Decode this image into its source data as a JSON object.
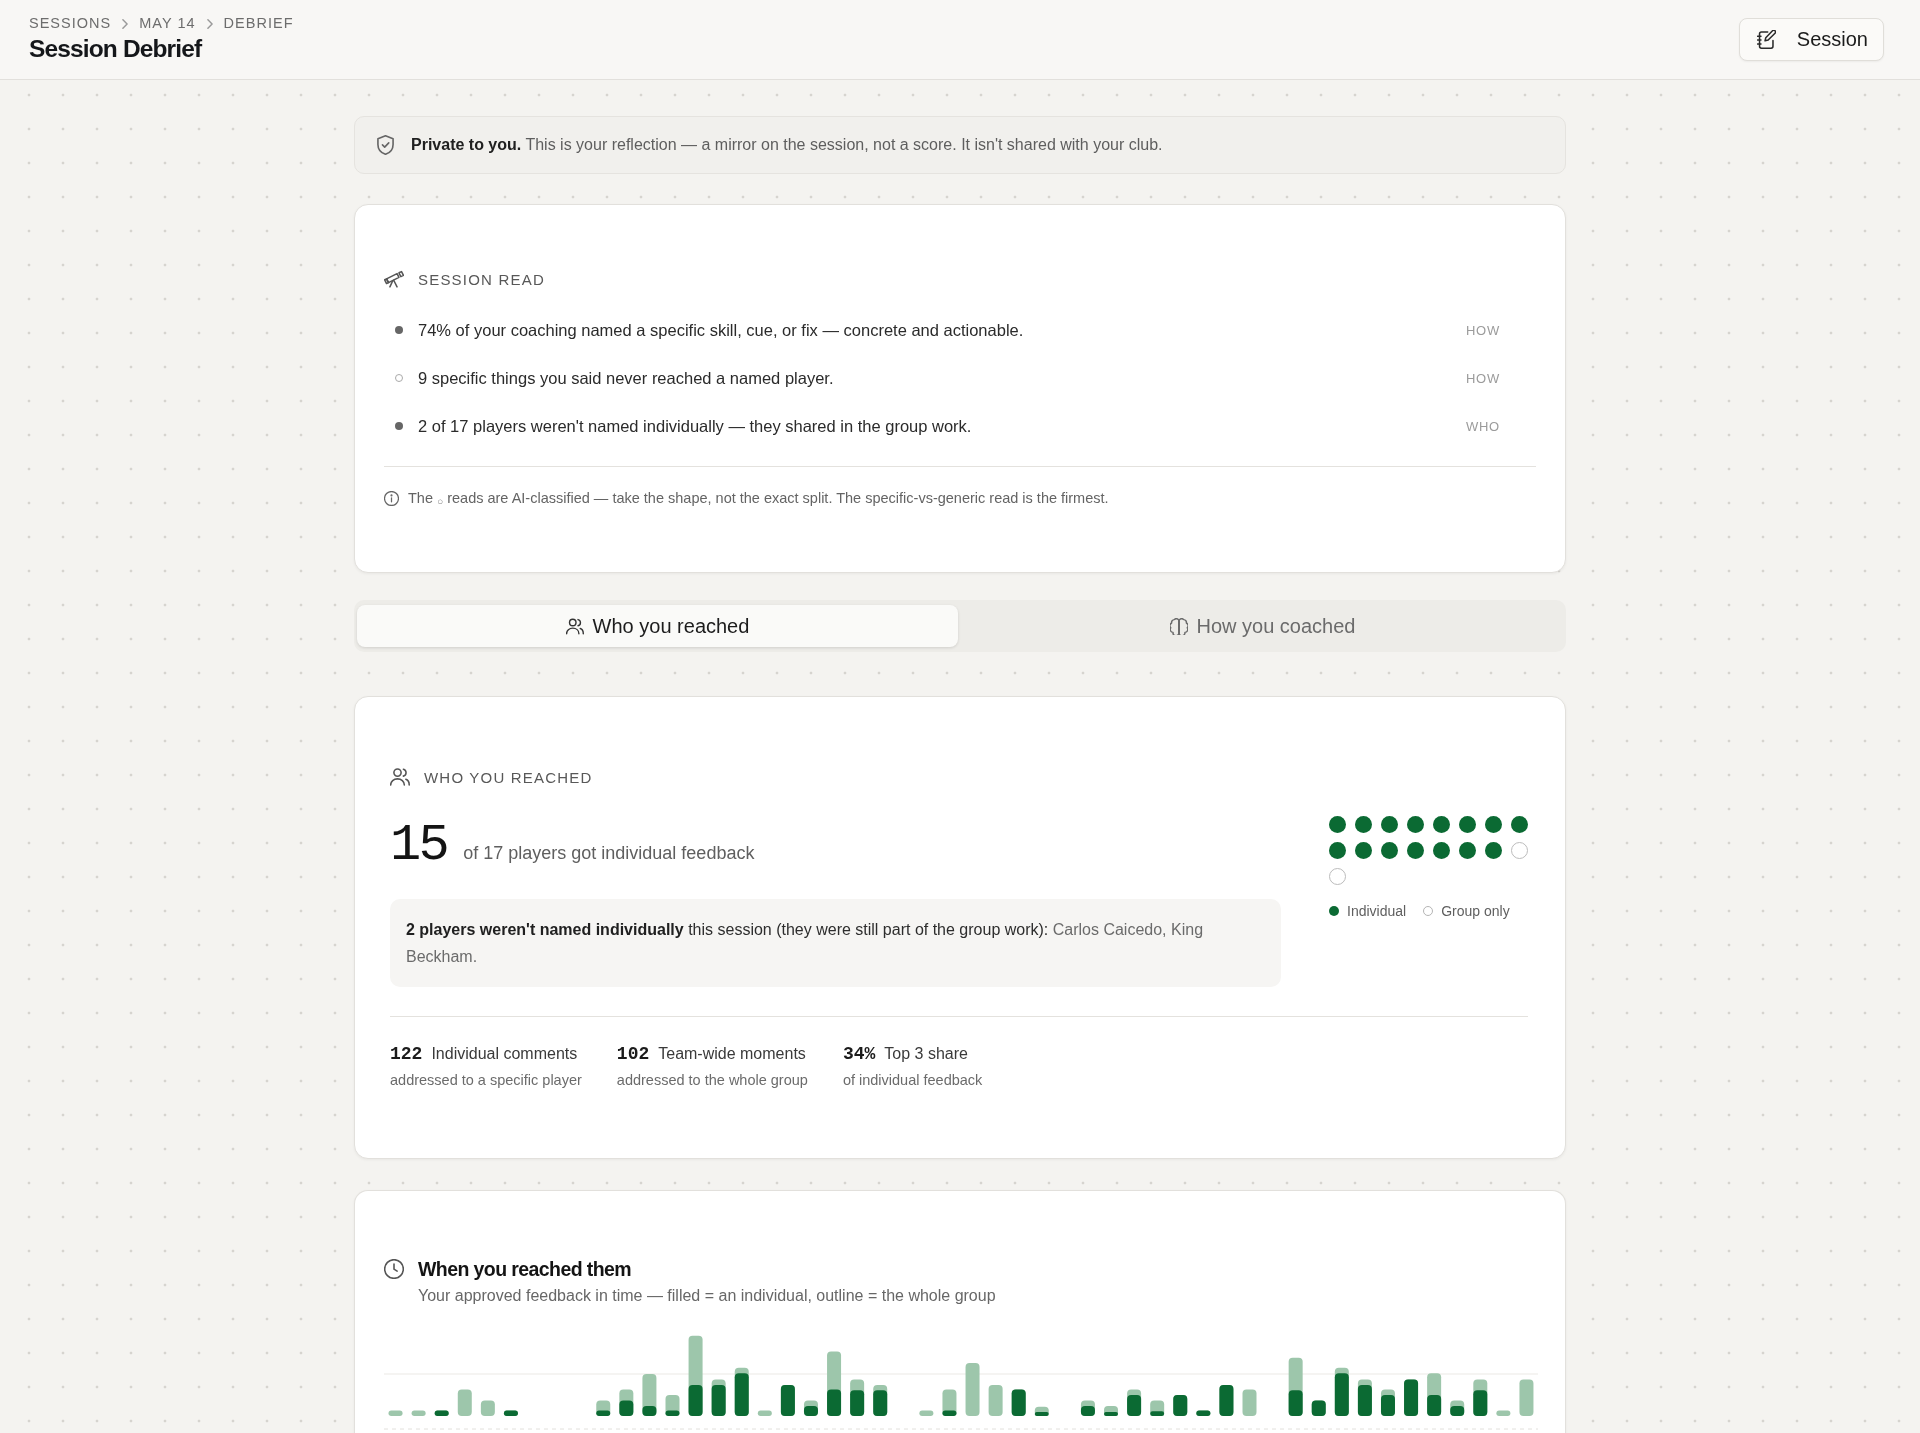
{
  "header": {
    "breadcrumbs": [
      "SESSIONS",
      "MAY 14",
      "DEBRIEF"
    ],
    "title": "Session Debrief",
    "button": "Session"
  },
  "privacy_banner": "**Private to you.** This is your reflection — a mirror on the session, not a score. It isn't shared with your club.",
  "session_read": {
    "title": "SESSION READ",
    "items": [
      {
        "text": "74% of your coaching named a specific skill, cue, or fix — concrete and actionable.",
        "tag": "HOW",
        "ai_classified": false
      },
      {
        "text": "9 specific things you said never reached a named player.",
        "tag": "HOW",
        "ai_classified": true
      },
      {
        "text": "2 of 17 players weren't named individually — they shared in the group work.",
        "tag": "WHO",
        "ai_classified": false
      }
    ],
    "footnote": "The $_{○}$ reads are AI-classified — take the shape, not the exact split. The specific-vs-generic read is the firmest."
  },
  "tabs": [
    {
      "label": "Who you reached",
      "selected": true
    },
    {
      "label": "How you coached",
      "selected": false
    }
  ],
  "who_reached": {
    "title": "WHO YOU REACHED",
    "count": "15",
    "count_label": "of 17 players got individual feedback",
    "note": {
      "text": "**2 players weren't named individually** this session (they were still part of the group work):",
      "names": "Carlos Caicedo, King Beckham."
    },
    "players": [
      {
        "individual": true
      },
      {
        "individual": true
      },
      {
        "individual": true
      },
      {
        "individual": true
      },
      {
        "individual": true
      },
      {
        "individual": true
      },
      {
        "individual": true
      },
      {
        "individual": true
      },
      {
        "individual": true
      },
      {
        "individual": true
      },
      {
        "individual": true
      },
      {
        "individual": true
      },
      {
        "individual": true
      },
      {
        "individual": true
      },
      {
        "individual": true
      },
      {
        "individual": false
      },
      {
        "individual": false
      }
    ],
    "legend": [
      {
        "label": "Individual",
        "kind": "filled"
      },
      {
        "label": "Group only",
        "kind": "outline"
      }
    ],
    "stats": [
      {
        "value": "122",
        "label": "Individual comments",
        "caption": "addressed to a specific player"
      },
      {
        "value": "102",
        "label": "Team-wide moments",
        "caption": "addressed to the whole group"
      },
      {
        "value": "34%",
        "label": "Top 3 share",
        "caption": "of individual feedback"
      }
    ]
  },
  "timeline": {
    "title": "When you reached them",
    "subtitle": "Your approved feedback in time — filled = an individual, outline = the whole group"
  }
}
